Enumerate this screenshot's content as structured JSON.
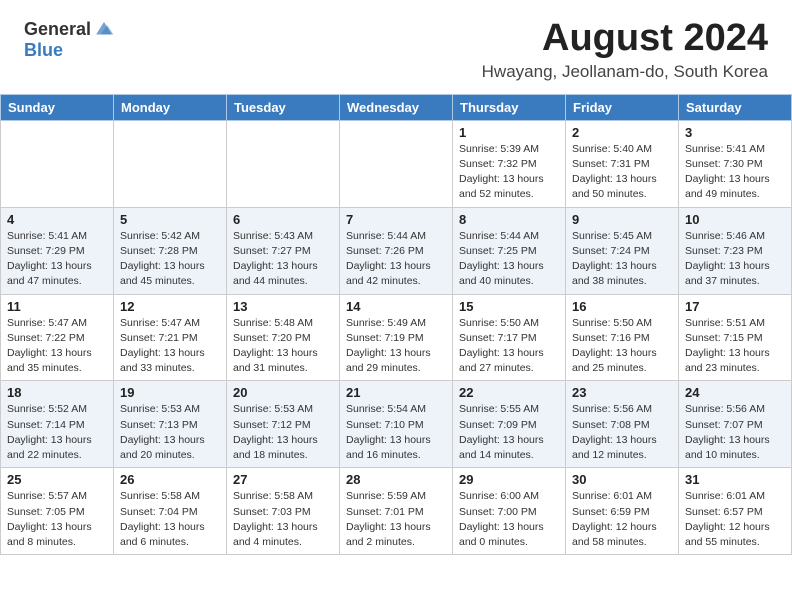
{
  "header": {
    "logo_general": "General",
    "logo_blue": "Blue",
    "month_title": "August 2024",
    "location": "Hwayang, Jeollanam-do, South Korea"
  },
  "weekdays": [
    "Sunday",
    "Monday",
    "Tuesday",
    "Wednesday",
    "Thursday",
    "Friday",
    "Saturday"
  ],
  "weeks": [
    [
      {
        "day": "",
        "detail": ""
      },
      {
        "day": "",
        "detail": ""
      },
      {
        "day": "",
        "detail": ""
      },
      {
        "day": "",
        "detail": ""
      },
      {
        "day": "1",
        "detail": "Sunrise: 5:39 AM\nSunset: 7:32 PM\nDaylight: 13 hours\nand 52 minutes."
      },
      {
        "day": "2",
        "detail": "Sunrise: 5:40 AM\nSunset: 7:31 PM\nDaylight: 13 hours\nand 50 minutes."
      },
      {
        "day": "3",
        "detail": "Sunrise: 5:41 AM\nSunset: 7:30 PM\nDaylight: 13 hours\nand 49 minutes."
      }
    ],
    [
      {
        "day": "4",
        "detail": "Sunrise: 5:41 AM\nSunset: 7:29 PM\nDaylight: 13 hours\nand 47 minutes."
      },
      {
        "day": "5",
        "detail": "Sunrise: 5:42 AM\nSunset: 7:28 PM\nDaylight: 13 hours\nand 45 minutes."
      },
      {
        "day": "6",
        "detail": "Sunrise: 5:43 AM\nSunset: 7:27 PM\nDaylight: 13 hours\nand 44 minutes."
      },
      {
        "day": "7",
        "detail": "Sunrise: 5:44 AM\nSunset: 7:26 PM\nDaylight: 13 hours\nand 42 minutes."
      },
      {
        "day": "8",
        "detail": "Sunrise: 5:44 AM\nSunset: 7:25 PM\nDaylight: 13 hours\nand 40 minutes."
      },
      {
        "day": "9",
        "detail": "Sunrise: 5:45 AM\nSunset: 7:24 PM\nDaylight: 13 hours\nand 38 minutes."
      },
      {
        "day": "10",
        "detail": "Sunrise: 5:46 AM\nSunset: 7:23 PM\nDaylight: 13 hours\nand 37 minutes."
      }
    ],
    [
      {
        "day": "11",
        "detail": "Sunrise: 5:47 AM\nSunset: 7:22 PM\nDaylight: 13 hours\nand 35 minutes."
      },
      {
        "day": "12",
        "detail": "Sunrise: 5:47 AM\nSunset: 7:21 PM\nDaylight: 13 hours\nand 33 minutes."
      },
      {
        "day": "13",
        "detail": "Sunrise: 5:48 AM\nSunset: 7:20 PM\nDaylight: 13 hours\nand 31 minutes."
      },
      {
        "day": "14",
        "detail": "Sunrise: 5:49 AM\nSunset: 7:19 PM\nDaylight: 13 hours\nand 29 minutes."
      },
      {
        "day": "15",
        "detail": "Sunrise: 5:50 AM\nSunset: 7:17 PM\nDaylight: 13 hours\nand 27 minutes."
      },
      {
        "day": "16",
        "detail": "Sunrise: 5:50 AM\nSunset: 7:16 PM\nDaylight: 13 hours\nand 25 minutes."
      },
      {
        "day": "17",
        "detail": "Sunrise: 5:51 AM\nSunset: 7:15 PM\nDaylight: 13 hours\nand 23 minutes."
      }
    ],
    [
      {
        "day": "18",
        "detail": "Sunrise: 5:52 AM\nSunset: 7:14 PM\nDaylight: 13 hours\nand 22 minutes."
      },
      {
        "day": "19",
        "detail": "Sunrise: 5:53 AM\nSunset: 7:13 PM\nDaylight: 13 hours\nand 20 minutes."
      },
      {
        "day": "20",
        "detail": "Sunrise: 5:53 AM\nSunset: 7:12 PM\nDaylight: 13 hours\nand 18 minutes."
      },
      {
        "day": "21",
        "detail": "Sunrise: 5:54 AM\nSunset: 7:10 PM\nDaylight: 13 hours\nand 16 minutes."
      },
      {
        "day": "22",
        "detail": "Sunrise: 5:55 AM\nSunset: 7:09 PM\nDaylight: 13 hours\nand 14 minutes."
      },
      {
        "day": "23",
        "detail": "Sunrise: 5:56 AM\nSunset: 7:08 PM\nDaylight: 13 hours\nand 12 minutes."
      },
      {
        "day": "24",
        "detail": "Sunrise: 5:56 AM\nSunset: 7:07 PM\nDaylight: 13 hours\nand 10 minutes."
      }
    ],
    [
      {
        "day": "25",
        "detail": "Sunrise: 5:57 AM\nSunset: 7:05 PM\nDaylight: 13 hours\nand 8 minutes."
      },
      {
        "day": "26",
        "detail": "Sunrise: 5:58 AM\nSunset: 7:04 PM\nDaylight: 13 hours\nand 6 minutes."
      },
      {
        "day": "27",
        "detail": "Sunrise: 5:58 AM\nSunset: 7:03 PM\nDaylight: 13 hours\nand 4 minutes."
      },
      {
        "day": "28",
        "detail": "Sunrise: 5:59 AM\nSunset: 7:01 PM\nDaylight: 13 hours\nand 2 minutes."
      },
      {
        "day": "29",
        "detail": "Sunrise: 6:00 AM\nSunset: 7:00 PM\nDaylight: 13 hours\nand 0 minutes."
      },
      {
        "day": "30",
        "detail": "Sunrise: 6:01 AM\nSunset: 6:59 PM\nDaylight: 12 hours\nand 58 minutes."
      },
      {
        "day": "31",
        "detail": "Sunrise: 6:01 AM\nSunset: 6:57 PM\nDaylight: 12 hours\nand 55 minutes."
      }
    ]
  ]
}
